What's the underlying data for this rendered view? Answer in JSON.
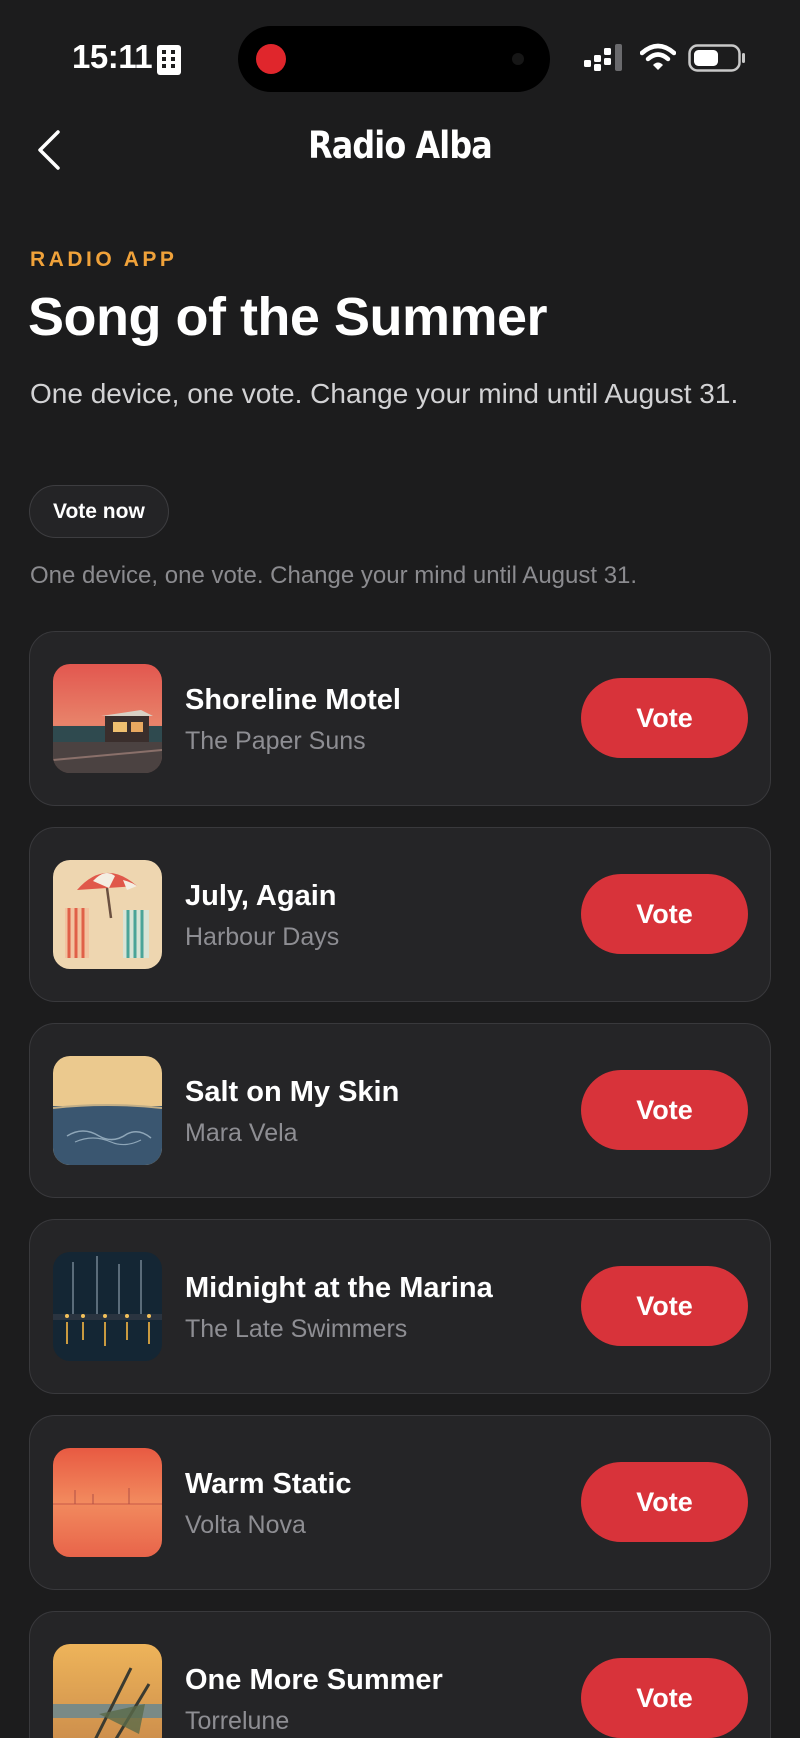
{
  "status_bar": {
    "time": "15:11",
    "icons": [
      "building-icon",
      "signal-icon",
      "wifi-icon",
      "battery-icon"
    ],
    "recording_color": "#e0262c"
  },
  "nav": {
    "title": "Radio Alba",
    "back_icon": "chevron-left-icon"
  },
  "header": {
    "eyebrow": "RADIO APP",
    "title": "Song of the Summer",
    "subtitle": "One device, one vote. Change your mind until August 31.",
    "chip_label": "Vote now",
    "note": "One device, one vote. Change your mind until August 31."
  },
  "colors": {
    "background": "#1c1c1d",
    "card": "#252527",
    "accent_eyebrow": "#f0a23a",
    "vote_button": "#d8333a"
  },
  "songs": [
    {
      "title": "Shoreline Motel",
      "artist": "The Paper Suns",
      "button": "Vote",
      "art": "sunset-motel-art"
    },
    {
      "title": "July, Again",
      "artist": "Harbour Days",
      "button": "Vote",
      "art": "beach-umbrella-art"
    },
    {
      "title": "Salt on My Skin",
      "artist": "Mara Vela",
      "button": "Vote",
      "art": "ocean-horizon-art"
    },
    {
      "title": "Midnight at the Marina",
      "artist": "The Late Swimmers",
      "button": "Vote",
      "art": "night-marina-art"
    },
    {
      "title": "Warm Static",
      "artist": "Volta Nova",
      "button": "Vote",
      "art": "orange-haze-art"
    },
    {
      "title": "One More Summer",
      "artist": "Torrelune",
      "button": "Vote",
      "art": "beach-chair-art"
    }
  ]
}
